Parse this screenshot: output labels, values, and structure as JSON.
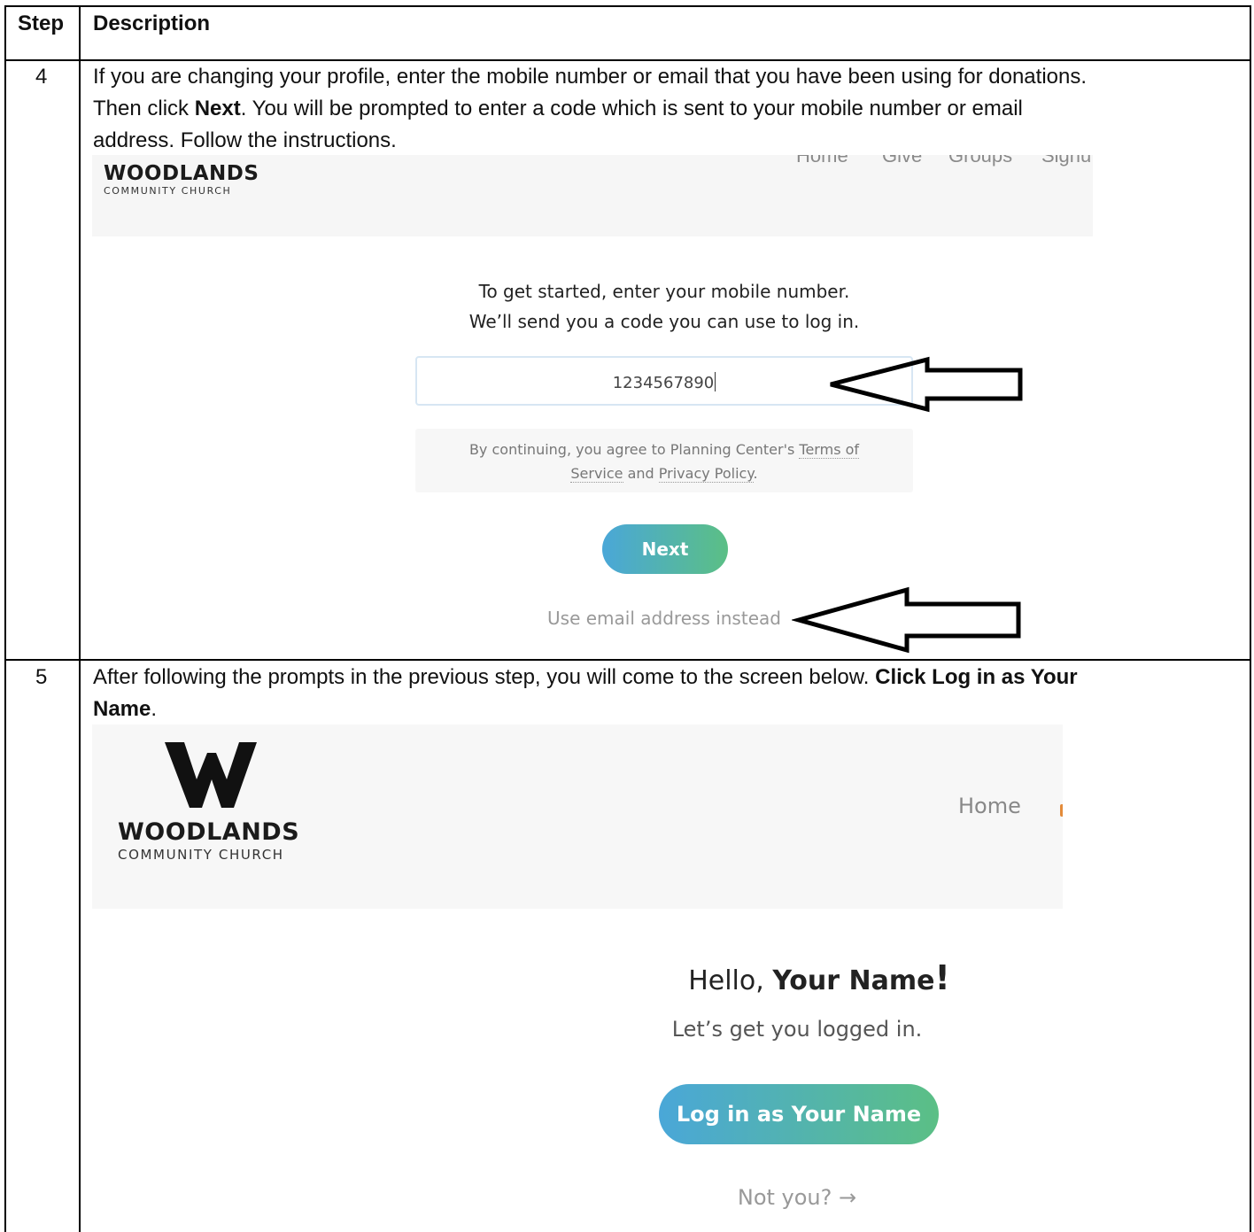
{
  "table": {
    "headers": {
      "step": "Step",
      "description": "Description"
    }
  },
  "step4": {
    "number": "4",
    "line1": "If you are changing your profile, enter the mobile number or email that you have been using for donations.",
    "line2_pre": "Then click ",
    "line2_bold": "Next",
    "line2_post": ".  You will be prompted to enter a code which is sent to your mobile number or email",
    "line3": "address.  Follow the instructions.",
    "screenshot": {
      "logo_name": "WOODLANDS",
      "logo_sub": "COMMUNITY CHURCH",
      "nav_cut": [
        "Home",
        "Give",
        "Groups",
        "Signu"
      ],
      "prompt_line1": "To get started, enter your mobile number.",
      "prompt_line2": "We’ll send you a code you can use to log in.",
      "phone_value": "1234567890",
      "terms_pre": "By continuing, you agree to Planning Center's ",
      "terms_link1": "Terms of",
      "terms_link1b": "Service",
      "terms_and": " and ",
      "terms_link2": "Privacy Policy",
      "terms_end": ".",
      "next_label": "Next",
      "email_link": "Use email address instead"
    }
  },
  "step5": {
    "number": "5",
    "line1_pre": "After following the prompts in the previous step, you will come to the screen below.  ",
    "line1_bold": "Click Log in as Your",
    "line2_bold": "Name",
    "line2_post": ".",
    "screenshot": {
      "logo_name": "WOODLANDS",
      "logo_sub": "COMMUNITY CHURCH",
      "nav_home": "Home",
      "hello_pre": "Hello, ",
      "hello_name": "Your Name",
      "hello_bang": "!",
      "subtitle": "Let’s get you logged in.",
      "login_label": "Log in as Your Name",
      "not_you": "Not you?"
    }
  },
  "colors": {
    "button_start": "#4aa7d8",
    "button_end": "#5bbf85",
    "nav_bg": "#f6f6f6"
  }
}
